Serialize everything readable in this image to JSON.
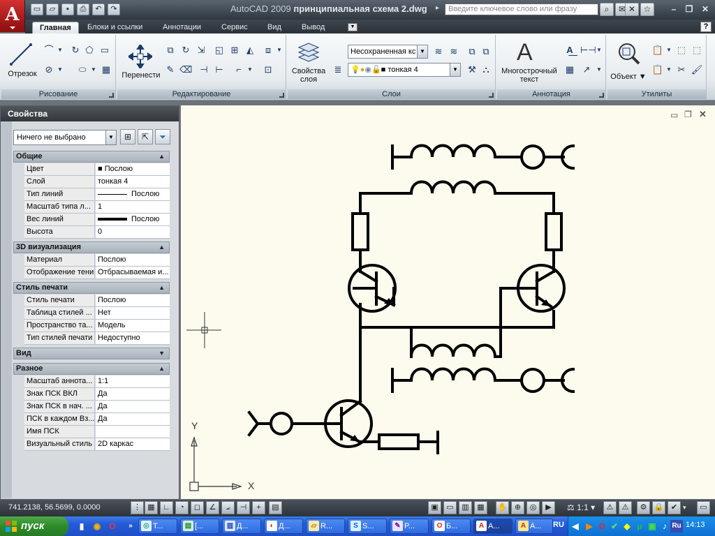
{
  "window": {
    "title_app": "AutoCAD 2009",
    "title_file": "принципиальная схема 2.dwg",
    "search_placeholder": "Введите ключевое слово или фразу"
  },
  "ribbon_tabs": [
    "Главная",
    "Блоки и ссылки",
    "Аннотации",
    "Сервис",
    "Вид",
    "Вывод"
  ],
  "panels": {
    "draw": {
      "title": "Рисование",
      "line_label": "Отрезок"
    },
    "modify": {
      "title": "Редактирование",
      "move_label": "Перенести"
    },
    "layers": {
      "title": "Слои",
      "props_label1": "Свойства",
      "props_label2": "слоя",
      "layer_state": "Несохраненная кс",
      "current_layer": "тонкая 4"
    },
    "annotation": {
      "title": "Аннотация",
      "mtext_label1": "Многострочный",
      "mtext_label2": "текст"
    },
    "utilities": {
      "title": "Утилиты",
      "object_label": "Объект"
    }
  },
  "properties": {
    "title": "Свойства",
    "selection": "Ничего не выбрано",
    "sections": [
      {
        "name": "Общие",
        "rows": [
          {
            "k": "Цвет",
            "v": "Послою"
          },
          {
            "k": "Слой",
            "v": "тонкая 4"
          },
          {
            "k": "Тип линий",
            "v": "Послою"
          },
          {
            "k": "Масштаб типа л...",
            "v": "1"
          },
          {
            "k": "Вес линий",
            "v": "Послою"
          },
          {
            "k": "Высота",
            "v": "0"
          }
        ]
      },
      {
        "name": "3D визуализация",
        "rows": [
          {
            "k": "Материал",
            "v": "Послою"
          },
          {
            "k": "Отображение тени",
            "v": "Отбрасываемая и..."
          }
        ]
      },
      {
        "name": "Стиль печати",
        "rows": [
          {
            "k": "Стиль печати",
            "v": "Послою"
          },
          {
            "k": "Таблица стилей ...",
            "v": "Нет"
          },
          {
            "k": "Пространство та...",
            "v": "Модель"
          },
          {
            "k": "Тип стилей печати",
            "v": "Недоступно"
          }
        ]
      },
      {
        "name": "Вид",
        "rows": []
      },
      {
        "name": "Разное",
        "rows": [
          {
            "k": "Масштаб аннота...",
            "v": "1:1"
          },
          {
            "k": "Знак ПСК ВКЛ",
            "v": "Да"
          },
          {
            "k": "Знак ПСК в нач. ...",
            "v": "Да"
          },
          {
            "k": "ПСК в каждом Вз...",
            "v": "Да"
          },
          {
            "k": "Имя ПСК",
            "v": ""
          },
          {
            "k": "Визуальный стиль",
            "v": "2D каркас"
          }
        ]
      }
    ]
  },
  "ucs": {
    "x": "X",
    "y": "Y"
  },
  "status": {
    "coords": "741.2138, 56.5699, 0.0000",
    "annotation_scale": "1:1"
  },
  "taskbar": {
    "start": "пуск",
    "tasks": [
      "T...",
      "[...",
      "Д...",
      "Д...",
      "R...",
      "S...",
      "P...",
      "Б...",
      "A...",
      "A..."
    ],
    "lang": "RU",
    "clock": "14:13"
  },
  "colors": {
    "canvas": "#fdfbee",
    "accent": "#c41e1e",
    "taskbar": "#245ad7"
  }
}
